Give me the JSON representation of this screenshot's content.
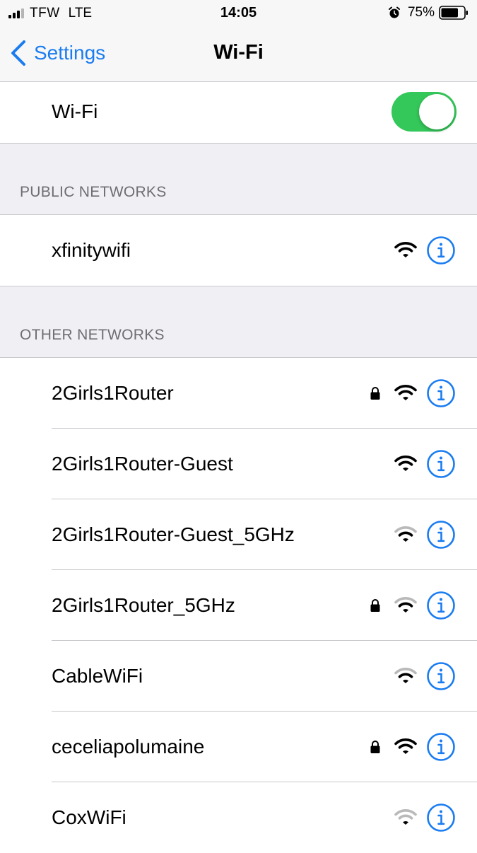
{
  "status_bar": {
    "carrier": "TFW",
    "network_type": "LTE",
    "time": "14:05",
    "battery": "75%"
  },
  "nav": {
    "back_label": "Settings",
    "title": "Wi-Fi"
  },
  "wifi_toggle": {
    "label": "Wi-Fi",
    "on": true
  },
  "public_networks": {
    "header": "PUBLIC NETWORKS",
    "items": [
      {
        "name": "xfinitywifi",
        "locked": false,
        "signal": "strong"
      }
    ]
  },
  "other_networks": {
    "header": "OTHER NETWORKS",
    "items": [
      {
        "name": "2Girls1Router",
        "locked": true,
        "signal": "strong"
      },
      {
        "name": "2Girls1Router-Guest",
        "locked": false,
        "signal": "strong"
      },
      {
        "name": "2Girls1Router-Guest_5GHz",
        "locked": false,
        "signal": "medium"
      },
      {
        "name": "2Girls1Router_5GHz",
        "locked": true,
        "signal": "medium"
      },
      {
        "name": "CableWiFi",
        "locked": false,
        "signal": "medium"
      },
      {
        "name": "ceceliapolumaine",
        "locked": true,
        "signal": "strong"
      },
      {
        "name": "CoxWiFi",
        "locked": false,
        "signal": "weak"
      }
    ]
  },
  "colors": {
    "accent": "#1a7cf0",
    "toggle_on": "#34c759",
    "group_background": "#efeff4",
    "separator": "#c8c7cc",
    "section_header": "#6d6d72"
  },
  "icons": {
    "back": "chevron-left-icon",
    "lock": "lock-icon",
    "wifi": "wifi-icon",
    "info": "info-icon",
    "alarm": "alarm-icon",
    "battery": "battery-icon",
    "signal": "cellular-signal-icon"
  }
}
